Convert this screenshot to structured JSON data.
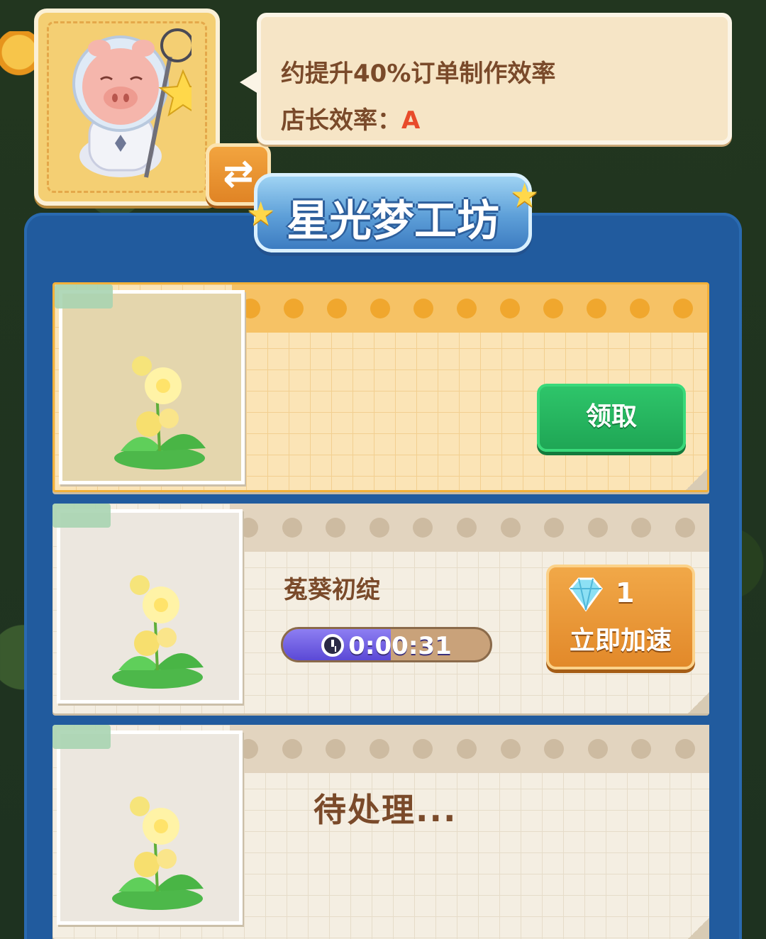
{
  "manager": {
    "info_line1": "约提升40%订单制作效率",
    "efficiency_label": "店长效率：",
    "efficiency_grade": "A",
    "swap_icon": "swap-arrows-icon",
    "portrait_icon": "pig-astronaut-icon"
  },
  "workshop": {
    "title": "星光梦工坊"
  },
  "slots": [
    {
      "state": "ready",
      "item_icon": "yellow-flower-icon",
      "collect_label": "领取"
    },
    {
      "state": "in_progress",
      "item_icon": "yellow-flower-icon",
      "item_name": "菟葵初绽",
      "timer": "0:00:31",
      "progress": 0.52,
      "speedup_cost": "1",
      "speedup_label": "立即加速",
      "gem_icon": "diamond-icon"
    },
    {
      "state": "pending",
      "item_icon": "yellow-flower-icon",
      "pending_label": "待处理..."
    }
  ],
  "colors": {
    "panel_blue": "#215b9e",
    "collect_green": "#1fa655",
    "speed_orange": "#e2892a",
    "progress_purple": "#5b49d6",
    "grade_red": "#e84b2b"
  }
}
